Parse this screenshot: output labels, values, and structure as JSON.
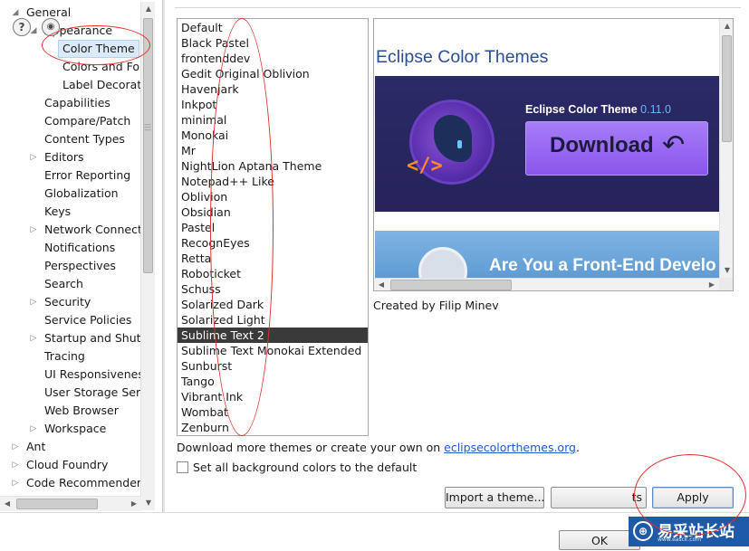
{
  "tree": {
    "items": [
      {
        "label": "General",
        "level": 0,
        "twisty": "expanded"
      },
      {
        "label": "Appearance",
        "level": 1,
        "twisty": "expanded"
      },
      {
        "label": "Color Theme",
        "level": 2,
        "twisty": "none",
        "selected": true
      },
      {
        "label": "Colors and Fon",
        "level": 2,
        "twisty": "none"
      },
      {
        "label": "Label Decoratio",
        "level": 2,
        "twisty": "none"
      },
      {
        "label": "Capabilities",
        "level": 1,
        "twisty": "none"
      },
      {
        "label": "Compare/Patch",
        "level": 1,
        "twisty": "none"
      },
      {
        "label": "Content Types",
        "level": 1,
        "twisty": "none"
      },
      {
        "label": "Editors",
        "level": 1,
        "twisty": "collapsed"
      },
      {
        "label": "Error Reporting",
        "level": 1,
        "twisty": "none"
      },
      {
        "label": "Globalization",
        "level": 1,
        "twisty": "none"
      },
      {
        "label": "Keys",
        "level": 1,
        "twisty": "none"
      },
      {
        "label": "Network Connectio",
        "level": 1,
        "twisty": "collapsed"
      },
      {
        "label": "Notifications",
        "level": 1,
        "twisty": "none"
      },
      {
        "label": "Perspectives",
        "level": 1,
        "twisty": "none"
      },
      {
        "label": "Search",
        "level": 1,
        "twisty": "none"
      },
      {
        "label": "Security",
        "level": 1,
        "twisty": "collapsed"
      },
      {
        "label": "Service Policies",
        "level": 1,
        "twisty": "none"
      },
      {
        "label": "Startup and Shutd",
        "level": 1,
        "twisty": "collapsed"
      },
      {
        "label": "Tracing",
        "level": 1,
        "twisty": "none"
      },
      {
        "label": "UI Responsiveness",
        "level": 1,
        "twisty": "none"
      },
      {
        "label": "User Storage Serv",
        "level": 1,
        "twisty": "none"
      },
      {
        "label": "Web Browser",
        "level": 1,
        "twisty": "none"
      },
      {
        "label": "Workspace",
        "level": 1,
        "twisty": "collapsed"
      },
      {
        "label": "Ant",
        "level": 0,
        "twisty": "collapsed"
      },
      {
        "label": "Cloud Foundry",
        "level": 0,
        "twisty": "collapsed"
      },
      {
        "label": "Code Recommenders",
        "level": 0,
        "twisty": "collapsed"
      }
    ]
  },
  "themes": {
    "items": [
      "Default",
      "Black Pastel",
      "frontenddev",
      "Gedit Original Oblivion",
      "Havenjark",
      "Inkpot",
      "minimal",
      "Monokai",
      "Mr",
      "NightLion Aptana Theme",
      "Notepad++ Like",
      "Oblivion",
      "Obsidian",
      "Pastel",
      "RecognEyes",
      "Retta",
      "Roboticket",
      "Schuss",
      "Solarized Dark",
      "Solarized Light",
      "Sublime Text 2",
      "Sublime Text Monokai Extended",
      "Sunburst",
      "Tango",
      "Vibrant Ink",
      "Wombat",
      "Zenburn"
    ],
    "selected": "Sublime Text 2"
  },
  "preview": {
    "title": "Eclipse Color Themes",
    "banner_prefix": "Eclipse Color Theme",
    "banner_version": "0.11.0",
    "download_label": "Download",
    "banner2_text": "Are You a Front-End Develo",
    "logo_code": "</>"
  },
  "created_by": "Created by Filip Minev",
  "download_line": {
    "prefix": "Download more themes or create your own on ",
    "link": "eclipsecolorthemes.org",
    "suffix": "."
  },
  "checkbox": {
    "label": "Set all background colors to the default",
    "checked": false
  },
  "buttons": {
    "import": "Import a theme...",
    "restore_partial": "ts",
    "apply": "Apply",
    "ok": "OK"
  },
  "footer": {
    "help_glyph": "?",
    "watermark_text": "易采站长站",
    "watermark_sub": "www.easck.com"
  },
  "colors": {
    "title_blue": "#2a4e98",
    "selection_dark": "#3a3a3a",
    "link_blue": "#1a5bd0",
    "annotation_red": "#e0332f"
  }
}
